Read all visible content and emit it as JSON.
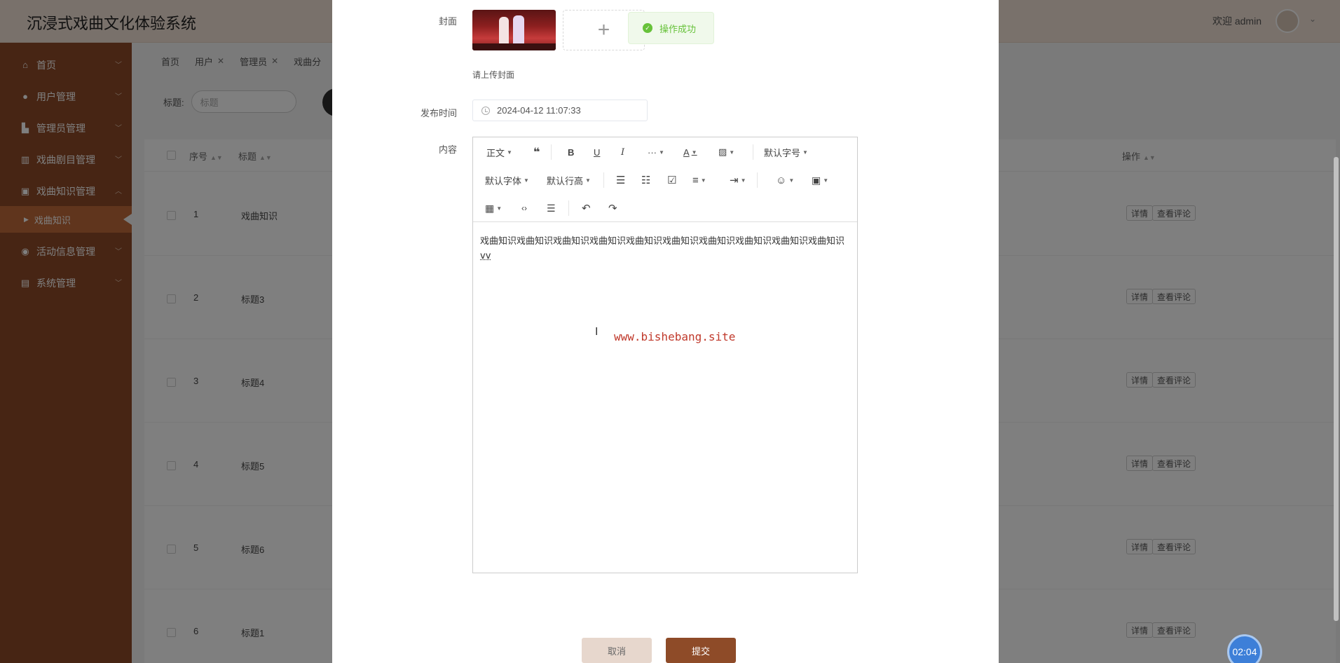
{
  "app": {
    "title": "沉浸式戏曲文化体验系统",
    "welcome": "欢迎 admin",
    "accent_color": "#8e4b28"
  },
  "sidebar": {
    "items": [
      {
        "label": "首页",
        "icon": "home-icon"
      },
      {
        "label": "用户管理",
        "icon": "user-icon"
      },
      {
        "label": "管理员管理",
        "icon": "admin-icon"
      },
      {
        "label": "戏曲剧目管理",
        "icon": "drama-icon"
      },
      {
        "label": "戏曲知识管理",
        "icon": "knowledge-icon"
      },
      {
        "label": "活动信息管理",
        "icon": "activity-icon"
      },
      {
        "label": "系统管理",
        "icon": "system-icon"
      }
    ],
    "active_sub": "戏曲知识"
  },
  "tabs": [
    {
      "label": "首页"
    },
    {
      "label": "用户"
    },
    {
      "label": "管理员"
    },
    {
      "label": "戏曲分"
    }
  ],
  "search": {
    "label": "标题:",
    "placeholder": "标题"
  },
  "table": {
    "headers": [
      "序号",
      "标题",
      "操作"
    ],
    "rows": [
      {
        "index": "1",
        "title": "戏曲知识"
      },
      {
        "index": "2",
        "title": "标题3"
      },
      {
        "index": "3",
        "title": "标题4"
      },
      {
        "index": "4",
        "title": "标题5"
      },
      {
        "index": "5",
        "title": "标题6"
      },
      {
        "index": "6",
        "title": "标题1"
      }
    ],
    "actions": [
      "详情",
      "查看评论"
    ]
  },
  "form": {
    "cover_label": "封面",
    "cover_hint": "请上传封面",
    "time_label": "发布时间",
    "time_value": "2024-04-12 11:07:33",
    "content_label": "内容",
    "content_text": "戏曲知识戏曲知识戏曲知识戏曲知识戏曲知识戏曲知识戏曲知识戏曲知识戏曲知识戏曲知识",
    "content_tail": "vv",
    "cancel_label": "取消",
    "submit_label": "提交"
  },
  "toast": {
    "text": "操作成功",
    "color": "#67c23a"
  },
  "editor_toolbar": {
    "paragraph": "正文",
    "font_size": "默认字号",
    "font_family": "默认字体",
    "line_height": "默认行高"
  },
  "watermark": "www.bishebang.site",
  "timer": "02:04"
}
